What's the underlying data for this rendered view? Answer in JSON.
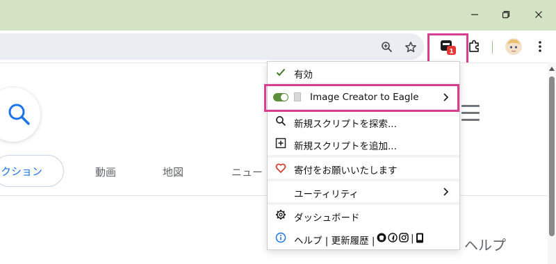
{
  "window": {
    "controls": [
      "minimize-icon",
      "restore-icon",
      "close-icon"
    ]
  },
  "toolbar": {
    "icons": [
      "zoom-icon",
      "bookmark-star-icon",
      "userscript-manager-icon",
      "extensions-icon",
      "profile-avatar-icon",
      "more-menu-icon"
    ],
    "badge_count": "1"
  },
  "page": {
    "tabs": [
      "クション",
      "動画",
      "地図",
      "ニュー"
    ],
    "help": "ヘルプ"
  },
  "menu": {
    "items": [
      {
        "icon": "check-icon",
        "label": "有効"
      },
      {
        "icon": "toggle-icon",
        "label": "Image Creator to Eagle",
        "has_submenu": true,
        "enabled": true
      },
      {
        "icon": "search-icon",
        "label": "新規スクリプトを探索..."
      },
      {
        "icon": "add-box-icon",
        "label": "新規スクリプトを追加..."
      },
      {
        "icon": "heart-icon",
        "label": "寄付をお願いいたします"
      },
      {
        "icon": "none",
        "label": "ユーティリティ",
        "has_submenu": true
      },
      {
        "icon": "gear-icon",
        "label": "ダッシュボード"
      },
      {
        "icon": "info-icon",
        "label": "ヘルプ | 更新履歴 |"
      }
    ]
  },
  "colors": {
    "titlebar": "#d3e3c3",
    "highlight": "#d93c93",
    "accent_blue": "#1a73e8",
    "toggle_green": "#5b8f3a",
    "badge_red": "#e53935",
    "heart_red": "#d9382f",
    "info_blue": "#1a73e8"
  }
}
